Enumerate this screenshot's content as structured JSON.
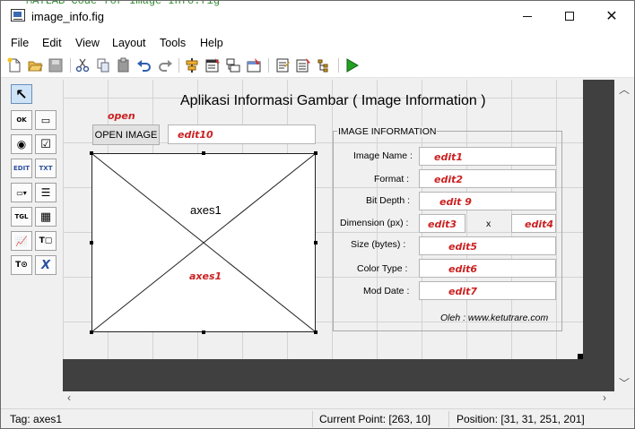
{
  "window": {
    "title": "image_info.fig",
    "background_text": "MATLAB Code for Image Info.fig"
  },
  "menu": [
    "File",
    "Edit",
    "View",
    "Layout",
    "Tools",
    "Help"
  ],
  "toolbar_icons": [
    "new-file-icon",
    "open-folder-icon",
    "save-icon",
    "cut-icon",
    "copy-icon",
    "paste-icon",
    "undo-icon",
    "redo-icon",
    "align-icon",
    "menu-editor-icon",
    "tab-order-icon",
    "toolbar-editor-icon",
    "editor-icon",
    "property-inspector-icon",
    "object-browser-icon",
    "run-icon"
  ],
  "palette": [
    {
      "name": "select-tool",
      "glyph": "↖"
    },
    {
      "name": "push-button-tool",
      "glyph": "OK"
    },
    {
      "name": "slider-tool",
      "glyph": "▭"
    },
    {
      "name": "radio-button-tool",
      "glyph": "◉"
    },
    {
      "name": "checkbox-tool",
      "glyph": "☑"
    },
    {
      "name": "edit-text-tool",
      "glyph": "EDIT"
    },
    {
      "name": "static-text-tool",
      "glyph": "TXT"
    },
    {
      "name": "popup-menu-tool",
      "glyph": "▭▾"
    },
    {
      "name": "listbox-tool",
      "glyph": "☰"
    },
    {
      "name": "toggle-button-tool",
      "glyph": "TGL"
    },
    {
      "name": "table-tool",
      "glyph": "▦"
    },
    {
      "name": "axes-tool",
      "glyph": "📈"
    },
    {
      "name": "panel-tool",
      "glyph": "T▢"
    },
    {
      "name": "button-group-tool",
      "glyph": "T⊙"
    },
    {
      "name": "activex-tool",
      "glyph": "X"
    }
  ],
  "figure": {
    "title": "Aplikasi Informasi Gambar ( Image Information )",
    "open_tag": "open",
    "open_button": "OPEN IMAGE",
    "edit10_tag": "edit10",
    "axes_label": "axes1",
    "axes_tag": "axes1",
    "panel_title": "IMAGE INFORMATION",
    "rows": [
      {
        "label": "Image Name :",
        "tag": "edit1"
      },
      {
        "label": "Format  :",
        "tag": "edit2"
      },
      {
        "label": "Bit Depth  :",
        "tag": "edit 9"
      },
      {
        "label": "Dimension (px)  :",
        "tag": "edit3"
      },
      {
        "label": "Size (bytes)  :",
        "tag": "edit5"
      },
      {
        "label": "Color Type  :",
        "tag": "edit6"
      },
      {
        "label": "Mod Date  :",
        "tag": "edit7"
      }
    ],
    "dimension_x": "x",
    "dimension_second_tag": "edit4",
    "credit": "Oleh : www.ketutrare.com"
  },
  "status": {
    "tag": "Tag: axes1",
    "current_point": "Current Point:  [263, 10]",
    "position": "Position: [31, 31, 251, 201]"
  },
  "colors": {
    "tag_red": "#cc2222",
    "run_green": "#22a022",
    "canvas_dark": "#404040"
  }
}
